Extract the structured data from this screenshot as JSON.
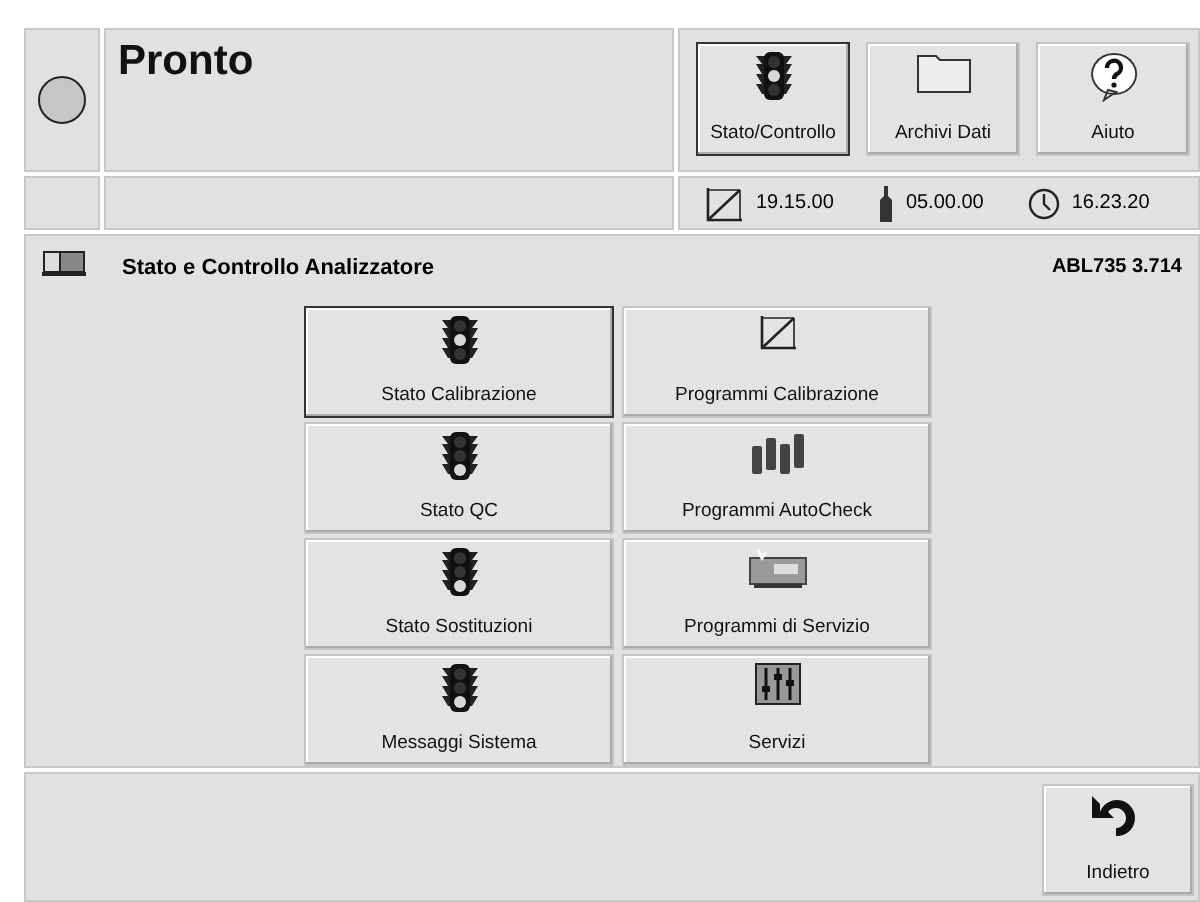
{
  "status": {
    "title": "Pronto"
  },
  "nav_buttons": [
    {
      "label": "Stato/Controllo",
      "kind": "traffic-middle",
      "selected": true
    },
    {
      "label": "Archivi Dati",
      "kind": "folder",
      "selected": false
    },
    {
      "label": "Aiuto",
      "kind": "help",
      "selected": false
    }
  ],
  "info_bar": [
    {
      "kind": "calibration",
      "value": "19.15.00"
    },
    {
      "kind": "bottle",
      "value": "05.00.00"
    },
    {
      "kind": "clock",
      "value": "16.23.20"
    }
  ],
  "panel": {
    "title": "Stato e Controllo Analizzatore",
    "version": "ABL735 3.714"
  },
  "menu_buttons": [
    {
      "label": "Stato Calibrazione",
      "kind": "traffic-middle",
      "selected": true
    },
    {
      "label": "Programmi Calibrazione",
      "kind": "calibration",
      "selected": false
    },
    {
      "label": "Stato QC",
      "kind": "traffic-bottom",
      "selected": false
    },
    {
      "label": "Programmi AutoCheck",
      "kind": "autocheck",
      "selected": false
    },
    {
      "label": "Stato Sostituzioni",
      "kind": "traffic-bottom",
      "selected": false
    },
    {
      "label": "Programmi di Servizio",
      "kind": "service",
      "selected": false
    },
    {
      "label": "Messaggi Sistema",
      "kind": "traffic-bottom",
      "selected": false
    },
    {
      "label": "Servizi",
      "kind": "services",
      "selected": false
    }
  ],
  "back_button": {
    "label": "Indietro"
  }
}
